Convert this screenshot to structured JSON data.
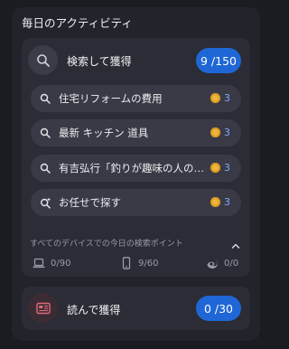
{
  "panel": {
    "title": "毎日のアクティビティ"
  },
  "search_earn": {
    "label": "検索して獲得",
    "progress": "9 /150",
    "items": [
      {
        "icon": "search-icon",
        "text": "住宅リフォームの費用",
        "points": "3"
      },
      {
        "icon": "search-icon",
        "text": "最新 キッチン 道具",
        "points": "3"
      },
      {
        "icon": "search-icon",
        "text": "有吉弘行「釣りが趣味の人の…",
        "points": "3"
      },
      {
        "icon": "sparkle-search-icon",
        "text": "お任せで探す",
        "points": "3"
      }
    ],
    "devices_title": "すべてのデバイスでの今日の検索ポイント",
    "devices": [
      {
        "icon": "laptop-icon",
        "value": "0/90"
      },
      {
        "icon": "phone-icon",
        "value": "9/60"
      },
      {
        "icon": "edge-icon",
        "value": "0/0"
      }
    ]
  },
  "read_earn": {
    "label": "読んで獲得",
    "progress": "0 /30"
  },
  "colors": {
    "accent": "#1f67d6",
    "coin": "#f0b53c",
    "points": "#7ba9ff"
  }
}
